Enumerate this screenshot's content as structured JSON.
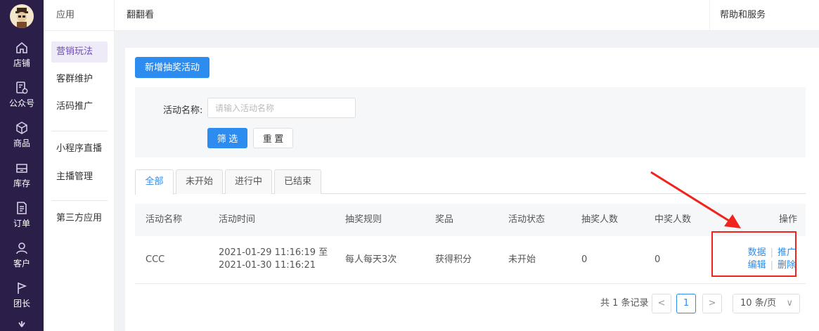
{
  "rail": {
    "items": [
      {
        "label": "店铺",
        "icon": "home-icon"
      },
      {
        "label": "公众号",
        "icon": "official-account-icon"
      },
      {
        "label": "商品",
        "icon": "box-icon"
      },
      {
        "label": "库存",
        "icon": "inventory-icon"
      },
      {
        "label": "订单",
        "icon": "order-icon"
      },
      {
        "label": "客户",
        "icon": "customer-icon"
      },
      {
        "label": "团长",
        "icon": "flag-icon"
      }
    ]
  },
  "sidebar": {
    "header": "应用",
    "items": [
      {
        "label": "营销玩法",
        "active": true
      },
      {
        "label": "客群维护",
        "active": false
      },
      {
        "label": "活码推广",
        "active": false
      },
      {
        "label": "小程序直播",
        "active": false
      },
      {
        "label": "主播管理",
        "active": false
      },
      {
        "label": "第三方应用",
        "active": false
      }
    ]
  },
  "topbar": {
    "title": "翻翻看",
    "help": "帮助和服务"
  },
  "main": {
    "add_button": "新增抽奖活动",
    "filter": {
      "label": "活动名称",
      "colon": ":",
      "placeholder": "请输入活动名称",
      "submit": "筛 选",
      "reset": "重 置"
    },
    "tabs": [
      {
        "label": "全部",
        "active": true
      },
      {
        "label": "未开始",
        "active": false
      },
      {
        "label": "进行中",
        "active": false
      },
      {
        "label": "已结束",
        "active": false
      }
    ],
    "table": {
      "columns": [
        "活动名称",
        "活动时间",
        "抽奖规则",
        "奖品",
        "活动状态",
        "抽奖人数",
        "中奖人数",
        "操作"
      ],
      "rows": [
        {
          "name": "CCC",
          "time_start": "2021-01-29 11:16:19 至",
          "time_end": "2021-01-30 11:16:21",
          "rule": "每人每天3次",
          "prize": "获得积分",
          "status": "未开始",
          "draw_count": "0",
          "win_count": "0",
          "ops": {
            "data": "数据",
            "promote": "推广",
            "edit": "编辑",
            "delete": "删除",
            "separator": "|"
          }
        }
      ]
    },
    "pagination": {
      "total": "共 1 条记录",
      "prev": "<",
      "current": "1",
      "next": ">",
      "page_size": "10 条/页",
      "chevron": "∨"
    }
  },
  "colors": {
    "rail_bg": "#2b1f4a",
    "primary": "#2d8cf0",
    "sidebar_active": "#6e4cb8",
    "annotation": "#f0241c"
  }
}
